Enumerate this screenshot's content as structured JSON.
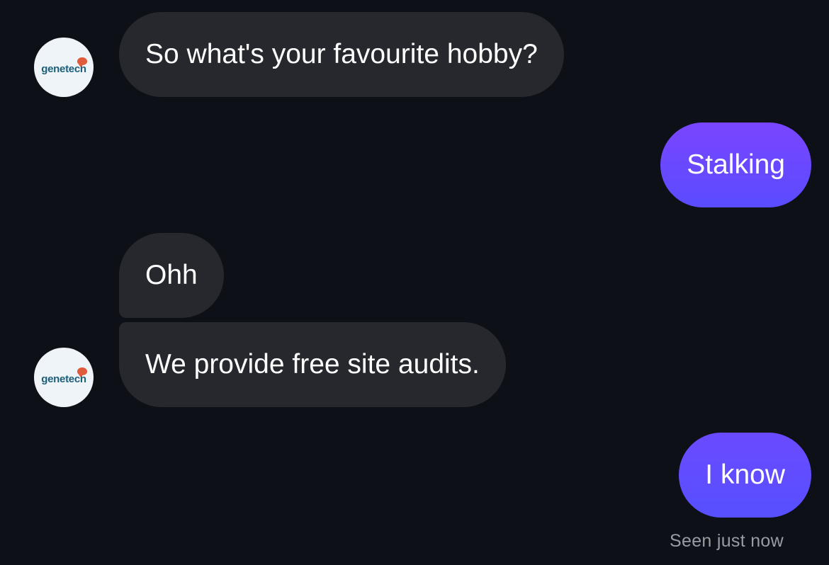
{
  "contact": {
    "avatar_logo_text": "genetech"
  },
  "messages": [
    {
      "direction": "incoming",
      "text": "So what's your favourite hobby?"
    },
    {
      "direction": "outgoing",
      "text": "Stalking"
    },
    {
      "direction": "incoming",
      "text": "Ohh"
    },
    {
      "direction": "incoming",
      "text": "We provide free site audits."
    },
    {
      "direction": "outgoing",
      "text": "I know"
    }
  ],
  "read_receipt": "Seen just now",
  "colors": {
    "background": "#0d1017",
    "incoming_bubble": "#26282e",
    "outgoing_bubble": "#6a4aff",
    "logo_text": "#1d5f7a",
    "logo_mark": "#e05a3c"
  },
  "icons": {
    "avatar": "genetech-logo-icon"
  }
}
